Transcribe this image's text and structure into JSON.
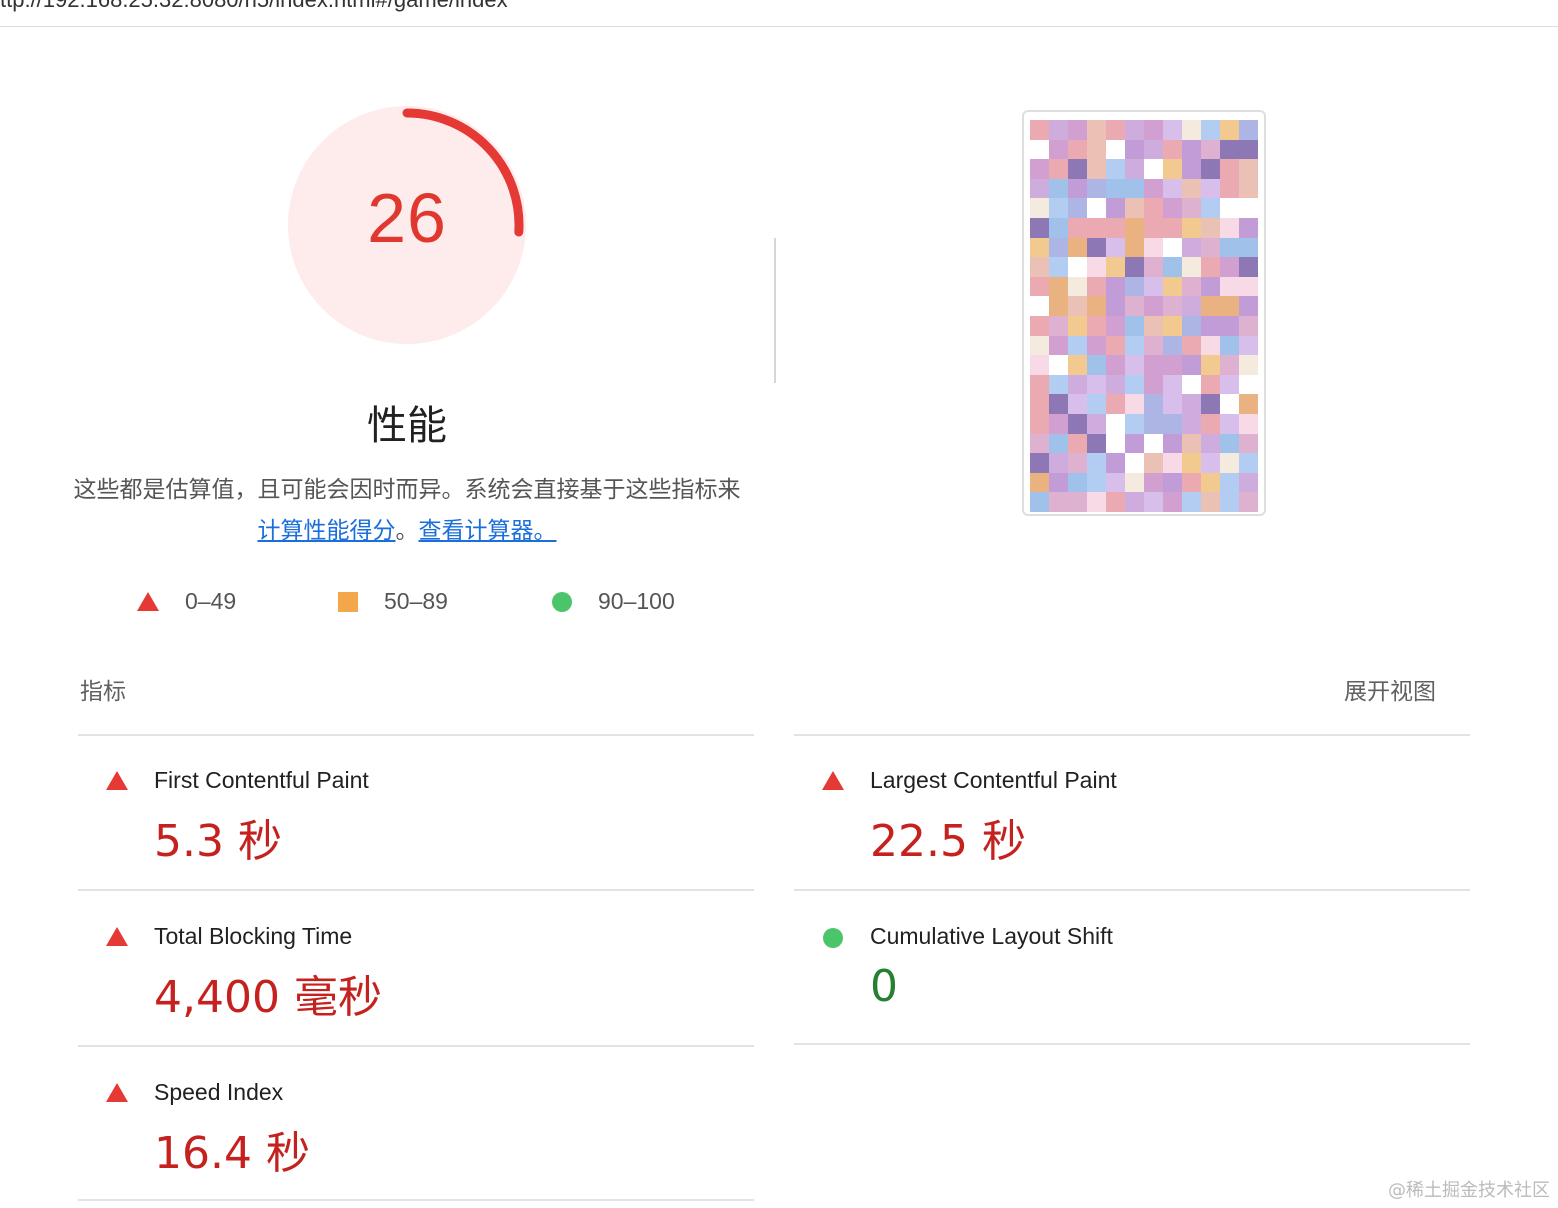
{
  "url": "ttp://192.168.25.32:8080/h5/index.html#/game/index",
  "score": {
    "value": "26",
    "fraction": 0.26,
    "title": "性能",
    "color": "#e53935"
  },
  "description": {
    "text": "这些都是估算值，且可能会因时而异。系统会直接基于这些指标来",
    "link1": "计算性能得分",
    "middle": "。",
    "link2": "查看计算器。"
  },
  "legend": [
    {
      "shape": "triangle",
      "color": "#e53935",
      "label": "0–49"
    },
    {
      "shape": "square",
      "color": "#f4a64a",
      "label": "50–89"
    },
    {
      "shape": "circle",
      "color": "#4cc56a",
      "label": "90–100"
    }
  ],
  "metrics_header": {
    "title": "指标",
    "expand_label": "展开视图"
  },
  "metrics": [
    {
      "label": "First Contentful Paint",
      "value": "5.3 秒",
      "status": "fail"
    },
    {
      "label": "Largest Contentful Paint",
      "value": "22.5 秒",
      "status": "fail"
    },
    {
      "label": "Total Blocking Time",
      "value": "4,400 毫秒",
      "status": "fail"
    },
    {
      "label": "Cumulative Layout Shift",
      "value": "0",
      "status": "pass"
    },
    {
      "label": "Speed Index",
      "value": "16.4 秒",
      "status": "fail"
    }
  ],
  "screenshot_preview": {
    "icon": "page-screenshot-thumbnail"
  },
  "watermark": "@稀土掘金技术社区"
}
